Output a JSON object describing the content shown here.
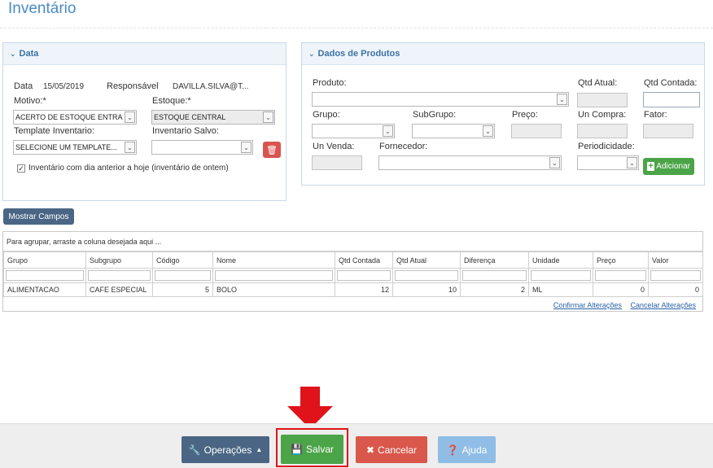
{
  "page": {
    "title": "Inventário"
  },
  "data_panel": {
    "header": "Data",
    "data_label": "Data",
    "data_value": "15/05/2019",
    "responsavel_label": "Responsável",
    "responsavel_value": "DAVILLA.SILVA@T...",
    "motivo_label": "Motivo:*",
    "motivo_value": "ACERTO DE ESTOQUE ENTRADA",
    "estoque_label": "Estoque:*",
    "estoque_value": "ESTOQUE CENTRAL",
    "template_label": "Template Inventario:",
    "template_value": "SELECIONE UM TEMPLATE...",
    "salvo_label": "Inventario Salvo:",
    "salvo_value": "",
    "checkbox_label": "Inventário com dia anterior a hoje (inventário de ontem)",
    "checkbox_checked": true
  },
  "produtos_panel": {
    "header": "Dados de Produtos",
    "produto_label": "Produto:",
    "qtd_atual_label": "Qtd Atual:",
    "qtd_contada_label": "Qtd Contada:",
    "grupo_label": "Grupo:",
    "subgrupo_label": "SubGrupo:",
    "preco_label": "Preço:",
    "un_compra_label": "Un Compra:",
    "fator_label": "Fator:",
    "un_venda_label": "Un Venda:",
    "fornecedor_label": "Fornecedor:",
    "periodicidade_label": "Periodicidade:",
    "add_button": "Adicionar"
  },
  "mostrar_campos": "Mostrar Campos",
  "grid": {
    "group_hint": "Para agrupar, arraste a coluna desejada aqui ...",
    "columns": [
      "Grupo",
      "Subgrupo",
      "Código",
      "Nome",
      "Qtd Contada",
      "Qtd Atual",
      "Diferença",
      "Unidade",
      "Preço",
      "Valor"
    ],
    "rows": [
      [
        "ALIMENTACAO",
        "CAFE ESPECIAL",
        "5",
        "BOLO",
        "12",
        "10",
        "2",
        "ML",
        "0",
        "0"
      ]
    ],
    "confirm_link": "Confirmar Alterações",
    "cancel_link": "Cancelar Alterações"
  },
  "bottom": {
    "operacoes": "Operações",
    "salvar": "Salvar",
    "cancelar": "Cancelar",
    "ajuda": "Ajuda"
  },
  "colors": {
    "title": "#4a8bc2",
    "operacoes_bg": "#4a6684",
    "salvar_bg": "#4ca449",
    "cancelar_bg": "#d9574b",
    "ajuda_bg": "#8fbde6",
    "highlight": "#e0131a"
  }
}
